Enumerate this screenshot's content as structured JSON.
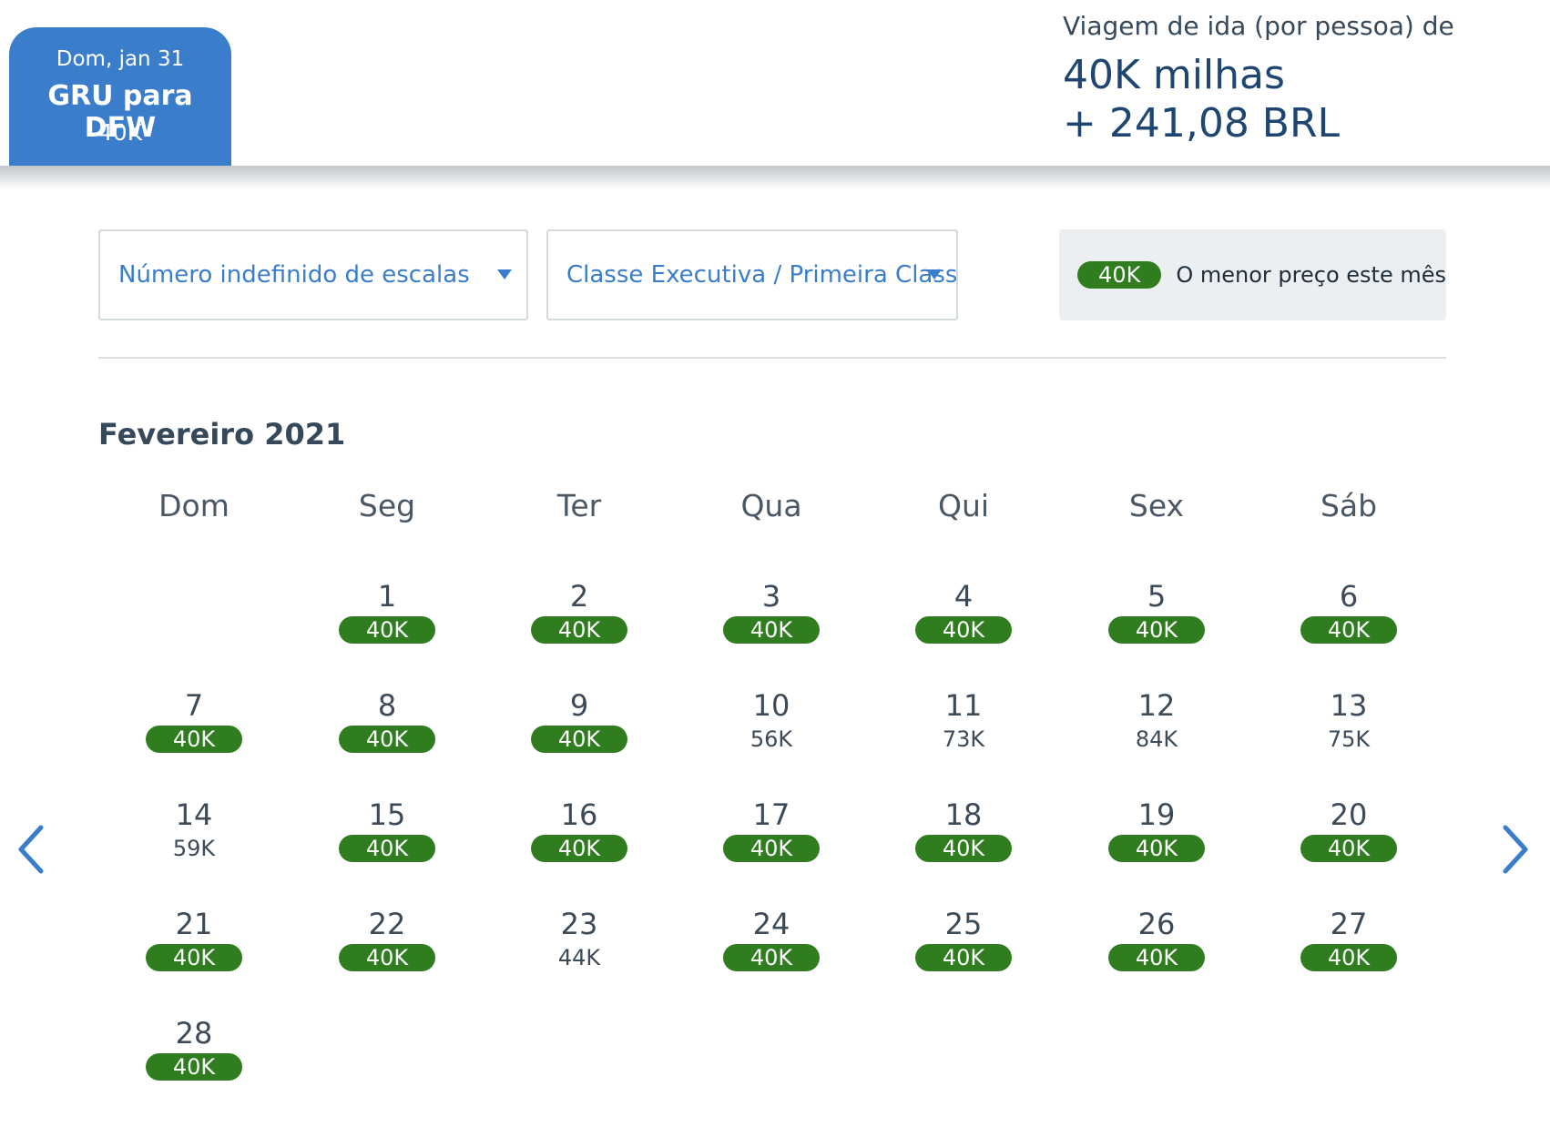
{
  "selected_date": {
    "date": "Dom, jan 31",
    "route": "GRU para DFW",
    "price": "40K"
  },
  "summary": {
    "label": "Viagem de ida (por pessoa) de",
    "miles": "40K milhas",
    "cash": "+ 241,08 BRL"
  },
  "filters": {
    "stops": "Número indefinido de escalas",
    "cabin": "Classe Executiva / Primeira Classe"
  },
  "legend": {
    "badge": "40K",
    "text": "O menor preço este mês"
  },
  "calendar": {
    "month": "Fevereiro 2021",
    "weekdays": [
      "Dom",
      "Seg",
      "Ter",
      "Qua",
      "Qui",
      "Sex",
      "Sáb"
    ],
    "days": [
      {
        "day": "1",
        "price": "40K",
        "lowest": true
      },
      {
        "day": "2",
        "price": "40K",
        "lowest": true
      },
      {
        "day": "3",
        "price": "40K",
        "lowest": true
      },
      {
        "day": "4",
        "price": "40K",
        "lowest": true
      },
      {
        "day": "5",
        "price": "40K",
        "lowest": true
      },
      {
        "day": "6",
        "price": "40K",
        "lowest": true
      },
      {
        "day": "7",
        "price": "40K",
        "lowest": true
      },
      {
        "day": "8",
        "price": "40K",
        "lowest": true
      },
      {
        "day": "9",
        "price": "40K",
        "lowest": true
      },
      {
        "day": "10",
        "price": "56K",
        "lowest": false
      },
      {
        "day": "11",
        "price": "73K",
        "lowest": false
      },
      {
        "day": "12",
        "price": "84K",
        "lowest": false
      },
      {
        "day": "13",
        "price": "75K",
        "lowest": false
      },
      {
        "day": "14",
        "price": "59K",
        "lowest": false
      },
      {
        "day": "15",
        "price": "40K",
        "lowest": true
      },
      {
        "day": "16",
        "price": "40K",
        "lowest": true
      },
      {
        "day": "17",
        "price": "40K",
        "lowest": true
      },
      {
        "day": "18",
        "price": "40K",
        "lowest": true
      },
      {
        "day": "19",
        "price": "40K",
        "lowest": true
      },
      {
        "day": "20",
        "price": "40K",
        "lowest": true
      },
      {
        "day": "21",
        "price": "40K",
        "lowest": true
      },
      {
        "day": "22",
        "price": "40K",
        "lowest": true
      },
      {
        "day": "23",
        "price": "44K",
        "lowest": false
      },
      {
        "day": "24",
        "price": "40K",
        "lowest": true
      },
      {
        "day": "25",
        "price": "40K",
        "lowest": true
      },
      {
        "day": "26",
        "price": "40K",
        "lowest": true
      },
      {
        "day": "27",
        "price": "40K",
        "lowest": true
      },
      {
        "day": "28",
        "price": "40K",
        "lowest": true
      }
    ]
  },
  "navigation": {
    "prev_icon": "chevron-left-icon",
    "next_icon": "chevron-right-icon"
  },
  "colors": {
    "accent": "#3a7ecb",
    "lowest_price": "#2f7d1f",
    "heading": "#1e4670"
  }
}
